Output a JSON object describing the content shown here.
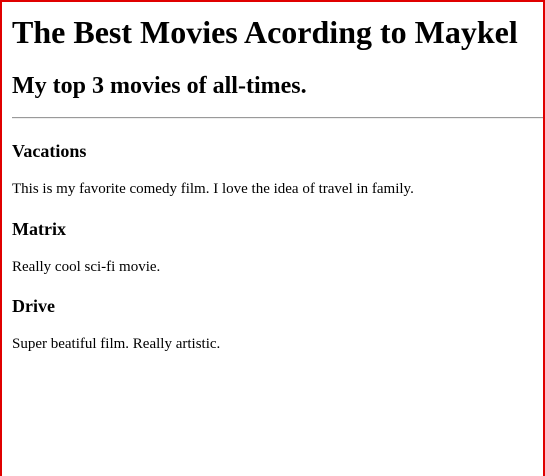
{
  "header": {
    "title": "The Best Movies Acording to Maykel",
    "subtitle": "My top 3 movies of all-times."
  },
  "movies": [
    {
      "title": "Vacations",
      "description": "This is my favorite comedy film. I love the idea of travel in family."
    },
    {
      "title": "Matrix",
      "description": "Really cool sci-fi movie."
    },
    {
      "title": "Drive",
      "description": "Super beatiful film. Really artistic."
    }
  ]
}
